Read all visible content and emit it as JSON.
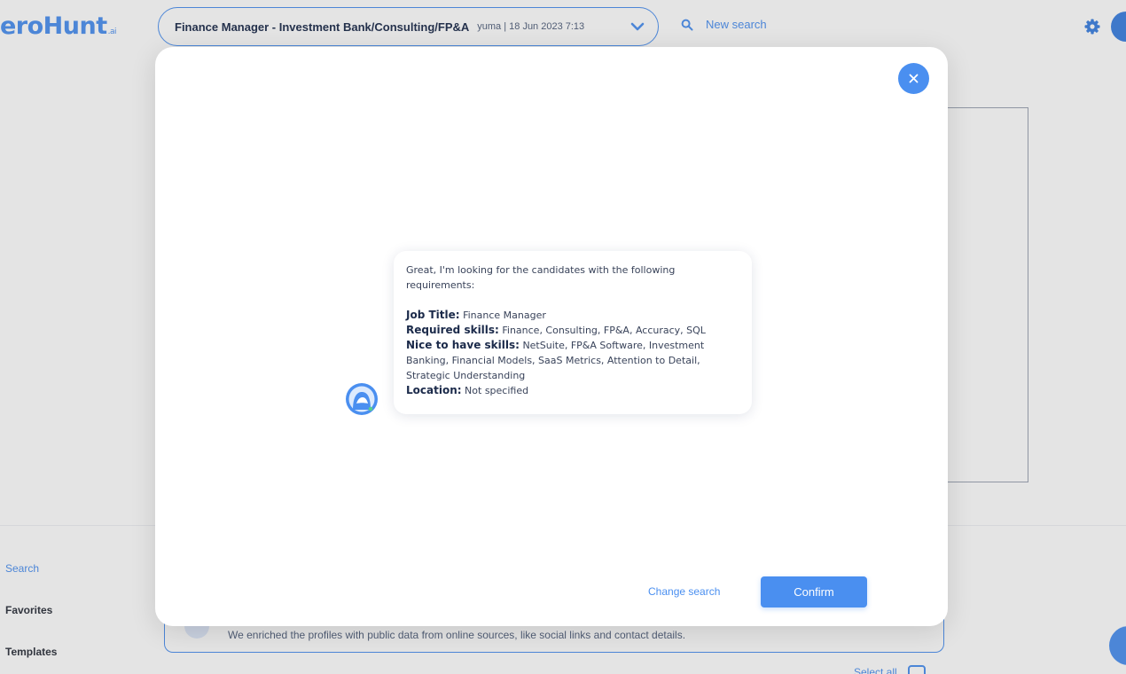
{
  "app": {
    "logo_text": "eroHunt",
    "logo_suffix": ".ai"
  },
  "header": {
    "search_title": "Finance Manager - Investment Bank/Consulting/FP&A",
    "search_meta": "yuma  |  18 Jun 2023 7:13",
    "new_search_label": "New search"
  },
  "sidebar": {
    "items": [
      {
        "label": "Search",
        "active": true
      },
      {
        "label": "Favorites",
        "active": false
      },
      {
        "label": "Templates",
        "active": false
      }
    ]
  },
  "enrich_banner": {
    "text": "We enriched the profiles with public data from online sources, like social links and contact details."
  },
  "select_all_label": "Select all",
  "modal": {
    "close_icon": "close-icon",
    "message": {
      "intro": "Great, I'm looking for the candidates with the following requirements:",
      "fields": [
        {
          "key": "Job Title:",
          "value": "Finance Manager"
        },
        {
          "key": "Required skills:",
          "value": "Finance, Consulting, FP&A, Accuracy, SQL"
        },
        {
          "key": "Nice to have skills:",
          "value": "NetSuite, FP&A Software, Investment Banking, Financial Models, SaaS Metrics, Attention to Detail, Strategic Understanding"
        },
        {
          "key": "Location:",
          "value": "Not specified"
        }
      ]
    },
    "change_search_label": "Change search",
    "confirm_label": "Confirm"
  },
  "colors": {
    "accent": "#4a8ff0",
    "text_dark": "#1b2a4a"
  }
}
